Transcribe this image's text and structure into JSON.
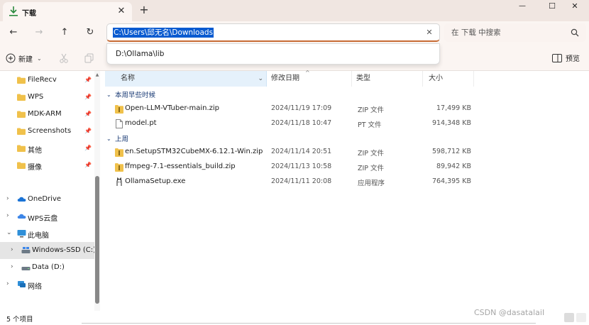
{
  "window": {
    "tab_title": "下载",
    "tab_close_glyph": "✕",
    "new_tab_glyph": "+",
    "minimize_glyph": "—",
    "maximize_glyph": "☐",
    "close_glyph": "✕"
  },
  "nav": {
    "back_glyph": "←",
    "forward_glyph": "→",
    "up_glyph": "↑",
    "refresh_glyph": "↻",
    "address_value": "C:\\Users\\邱无名\\Downloads",
    "clear_glyph": "✕",
    "search_placeholder": "在 下载 中搜索"
  },
  "address_suggestions": [
    "D:\\Ollama\\lib"
  ],
  "commandbar": {
    "new_label": "新建",
    "new_chevron": "⌄",
    "preview_label": "预览"
  },
  "sidebar": {
    "quick_access": [
      {
        "label": "FileRecv",
        "pinned": true
      },
      {
        "label": "WPS",
        "pinned": true
      },
      {
        "label": "MDK-ARM",
        "pinned": true
      },
      {
        "label": "Screenshots",
        "pinned": true
      },
      {
        "label": "其他",
        "pinned": true
      },
      {
        "label": "摄像",
        "pinned": true
      }
    ],
    "locations": [
      {
        "label": "OneDrive",
        "icon": "cloud-icon",
        "expanded": false
      },
      {
        "label": "WPS云盘",
        "icon": "wps-cloud-icon",
        "expanded": false
      },
      {
        "label": "此电脑",
        "icon": "computer-icon",
        "expanded": true
      },
      {
        "label": "Windows-SSD (C:)",
        "icon": "drive-icon",
        "expanded": false,
        "selected": true
      },
      {
        "label": "Data (D:)",
        "icon": "drive-icon",
        "expanded": false
      },
      {
        "label": "网络",
        "icon": "network-icon",
        "expanded": false
      }
    ]
  },
  "columns": {
    "name": "名称",
    "date": "修改日期",
    "type": "类型",
    "size": "大小"
  },
  "groups": [
    {
      "label": "本周早些时候",
      "files": [
        {
          "name": "Open-LLM-VTuber-main.zip",
          "date": "2024/11/19 17:09",
          "type": "ZIP 文件",
          "size": "17,499 KB",
          "icon": "zip-icon"
        },
        {
          "name": "model.pt",
          "date": "2024/11/18 10:47",
          "type": "PT 文件",
          "size": "914,348 KB",
          "icon": "file-icon"
        }
      ]
    },
    {
      "label": "上周",
      "files": [
        {
          "name": "en.SetupSTM32CubeMX-6.12.1-Win.zip",
          "date": "2024/11/14 20:51",
          "type": "ZIP 文件",
          "size": "598,712 KB",
          "icon": "zip-icon"
        },
        {
          "name": "ffmpeg-7.1-essentials_build.zip",
          "date": "2024/11/13 10:58",
          "type": "ZIP 文件",
          "size": "89,942 KB",
          "icon": "zip-icon"
        },
        {
          "name": "OllamaSetup.exe",
          "date": "2024/11/11 20:08",
          "type": "应用程序",
          "size": "764,395 KB",
          "icon": "ollama-icon"
        }
      ]
    }
  ],
  "status": {
    "item_count": "5 个项目"
  },
  "watermark": "CSDN @dasatalaiI",
  "colors": {
    "accent": "#0a5bd0",
    "titlebar": "#f0e6e1",
    "folder": "#f0c14b",
    "group_header": "#1f3f78"
  }
}
